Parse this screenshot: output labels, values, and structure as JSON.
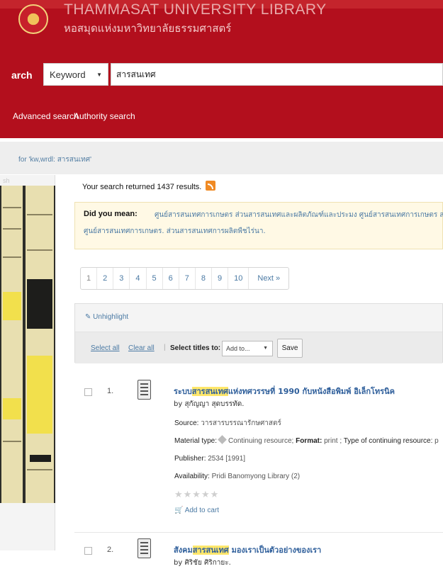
{
  "header": {
    "title": "THAMMASAT UNIVERSITY LIBRARY",
    "subtitle": "หอสมุดแห่งมหาวิทยาลัยธรรมศาสตร์",
    "search_label": "arch",
    "search_type": "Keyword",
    "search_value": "สารสนเทศ",
    "advanced_link": "Advanced search",
    "authority_link": "Authority search",
    "colors": {
      "primary": "#b30f1d"
    }
  },
  "breadcrumb": "for 'kw,wrdl: สารสนเทศ'",
  "left_panel": {
    "refine_text": "sh"
  },
  "results": {
    "summary": "Your search returned 1437 results.",
    "did_you_mean": {
      "label": "Did you mean:",
      "line1": "ศูนย์สารสนเทศการเกษตร ส่วนสารสนเทศและผลิตภัณฑ์และประมง   ศูนย์สารสนเทศการเกษตร ส่ว",
      "line2": "ศูนย์สารสนเทศการเกษตร. ส่วนสารสนเทศการผลิตพืชไร่นา."
    },
    "pagination": [
      "1",
      "2",
      "3",
      "4",
      "5",
      "6",
      "7",
      "8",
      "9",
      "10",
      "Next »"
    ],
    "toolbar": {
      "unhighlight": "Unhighlight",
      "select_all": "Select all",
      "clear_all": "Clear all",
      "separator": "|",
      "select_titles": "Select titles to:",
      "add_to": "Add to...",
      "save": "Save"
    },
    "items": [
      {
        "num": "1.",
        "title_prefix": "ระบบ",
        "title_highlight": "สารสนเทศ",
        "title_suffix": "แห่งทศวรรษที่ 1990 กับหนังสือพิมพ์ อิเล็กโทรนิค",
        "author": "by สุกัญญา สุดบรรทัด.",
        "source_label": "Source:",
        "source": "วารสารบรรณารักษศาสตร์",
        "material_label": "Material type:",
        "material": "Continuing resource;",
        "format_label": "Format:",
        "format": "print ;",
        "continuing_label": "Type of continuing resource:",
        "continuing": "p",
        "publisher_label": "Publisher:",
        "publisher": "2534 [1991]",
        "availability_label": "Availability:",
        "availability": "Pridi Banomyong Library (2)",
        "stars": "★★★★★",
        "add_to_cart": "Add to cart"
      },
      {
        "num": "2.",
        "title_prefix": "สังคม",
        "title_highlight": "สารสนเทศ",
        "title_suffix": " มองเราเป็นตัวอย่างของเรา",
        "author": "by ศิริชัย ศิริกายะ."
      }
    ]
  }
}
